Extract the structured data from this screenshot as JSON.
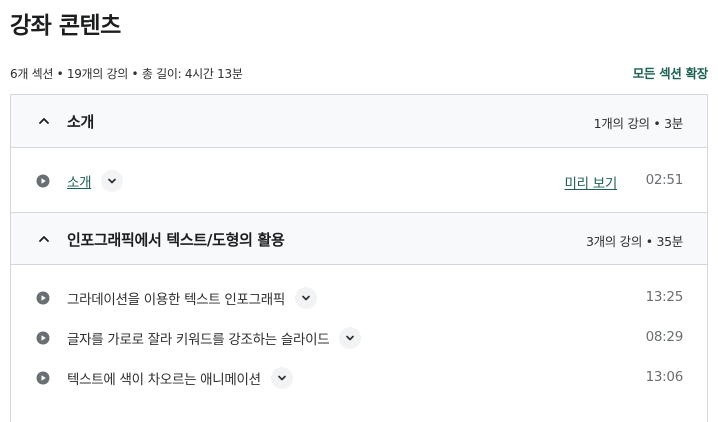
{
  "page": {
    "title": "강좌 콘텐츠"
  },
  "summary": {
    "text": "6개 섹션 • 19개의 강의 • 총 길이: 4시간 13분",
    "expand_all": "모든 섹션 확장"
  },
  "sections": [
    {
      "title": "소개",
      "meta": "1개의 강의 • 3분",
      "expanded": true,
      "lectures": [
        {
          "title": "소개",
          "preview": "미리 보기",
          "duration": "02:51"
        }
      ]
    },
    {
      "title": "인포그래픽에서 텍스트/도형의 활용",
      "meta": "3개의 강의 • 35분",
      "expanded": true,
      "lectures": [
        {
          "title": "그라데이션을 이용한 텍스트 인포그래픽",
          "duration": "13:25"
        },
        {
          "title": "글자를 가로로 잘라 키워드를 강조하는 슬라이드",
          "duration": "08:29"
        },
        {
          "title": "텍스트에 색이 차오르는 애니메이션",
          "duration": "13:06"
        }
      ]
    }
  ],
  "icons": {
    "section_toggle": "chevron-up-icon",
    "lecture": "play-circle-icon",
    "lecture_dropdown": "chevron-down-icon"
  },
  "colors": {
    "link": "#1e6055",
    "header_bg": "#f7f9fa",
    "border": "#d1d7dc",
    "muted": "#6a6f73"
  }
}
